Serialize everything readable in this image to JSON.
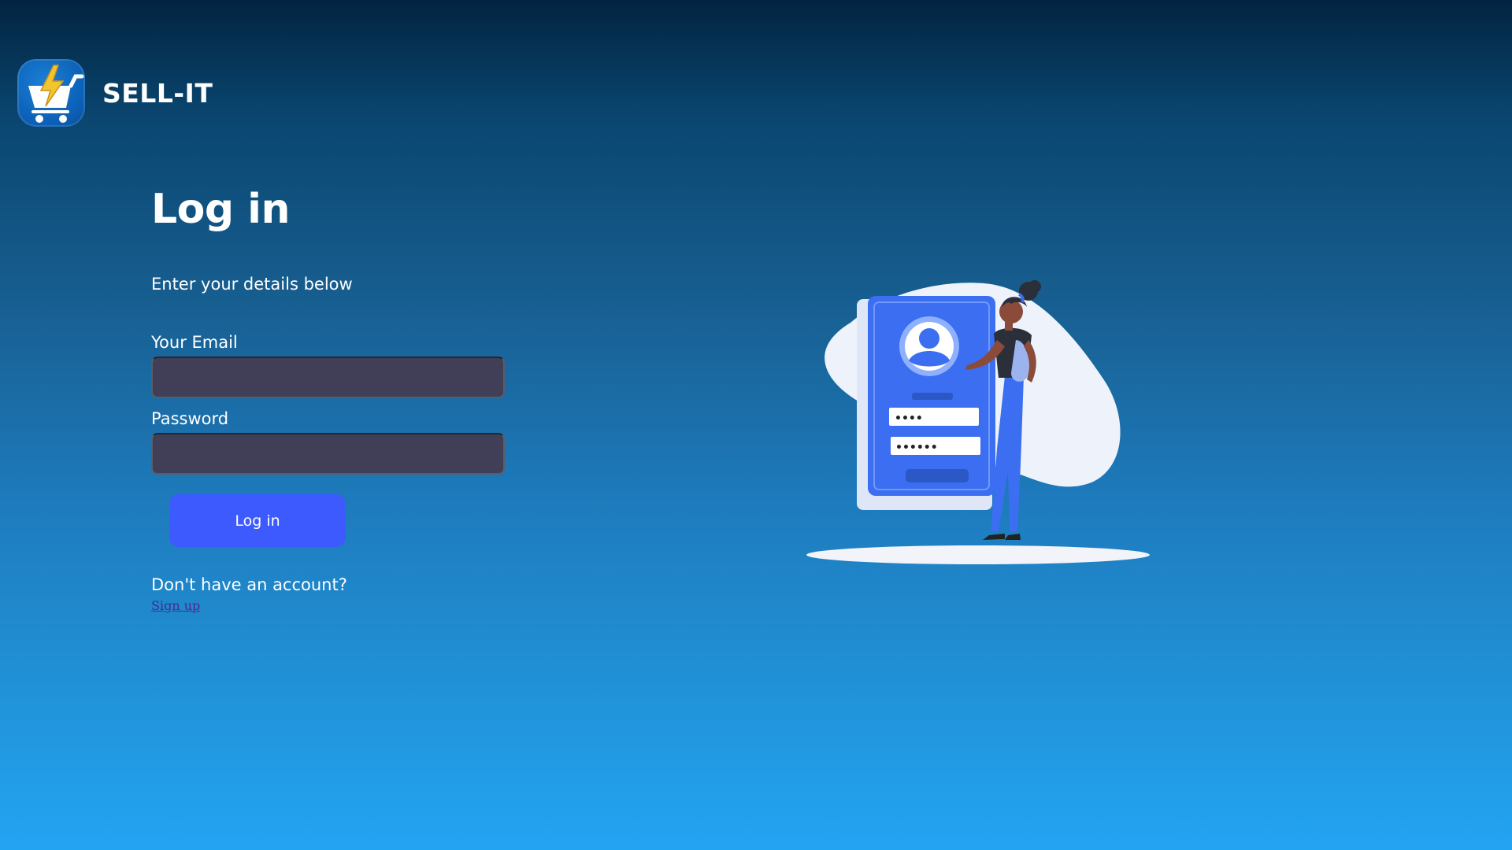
{
  "brand": {
    "name": "SELL-IT",
    "logo_icon": "cart-lightning-logo"
  },
  "login": {
    "title": "Log in",
    "subtitle": "Enter your details below",
    "email_label": "Your Email",
    "email_value": "",
    "password_label": "Password",
    "password_value": "",
    "submit_label": "Log in",
    "no_account_text": "Don't have an account?",
    "signup_link": "Sign up"
  },
  "colors": {
    "button": "#3d5afe",
    "input_bg": "#413f57",
    "link": "#4a2a8a"
  },
  "illustration": {
    "icon": "login-illustration",
    "masked_field_1": "••••",
    "masked_field_2": "••••••"
  }
}
